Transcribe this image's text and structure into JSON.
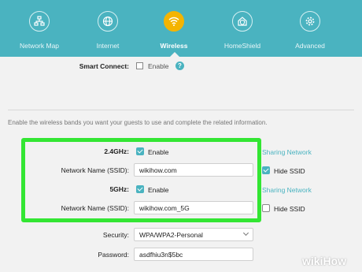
{
  "nav": {
    "items": [
      {
        "label": "Network Map",
        "icon": "network-map-icon",
        "active": false
      },
      {
        "label": "Internet",
        "icon": "globe-icon",
        "active": false
      },
      {
        "label": "Wireless",
        "icon": "wifi-icon",
        "active": true
      },
      {
        "label": "HomeShield",
        "icon": "home-shield-icon",
        "active": false
      },
      {
        "label": "Advanced",
        "icon": "gear-icon",
        "active": false
      }
    ],
    "colors": {
      "bar": "#4ab3c0",
      "active": "#f4b400"
    }
  },
  "smart_connect": {
    "label": "Smart Connect:",
    "enable": "Enable"
  },
  "intro": "Enable the wireless bands you want your guests to use and complete the related information.",
  "band_24": {
    "label": "2.4GHz:",
    "enable": "Enable",
    "ssid_label": "Network Name (SSID):",
    "ssid_value": "wikihow.com",
    "sharing": "Sharing Network",
    "hide_ssid": "Hide SSID"
  },
  "band_5": {
    "label": "5GHz:",
    "enable": "Enable",
    "ssid_label": "Network Name (SSID):",
    "ssid_value": "wikihow.com_5G",
    "sharing": "Sharing Network",
    "hide_ssid": "Hide SSID"
  },
  "security": {
    "label": "Security:",
    "value": "WPA/WPA2-Personal"
  },
  "password": {
    "label": "Password:",
    "value": "asdfhiu3n$5bc"
  },
  "highlight_color": "#33e633",
  "watermark": {
    "wiki": "wiki",
    "how": "How"
  }
}
